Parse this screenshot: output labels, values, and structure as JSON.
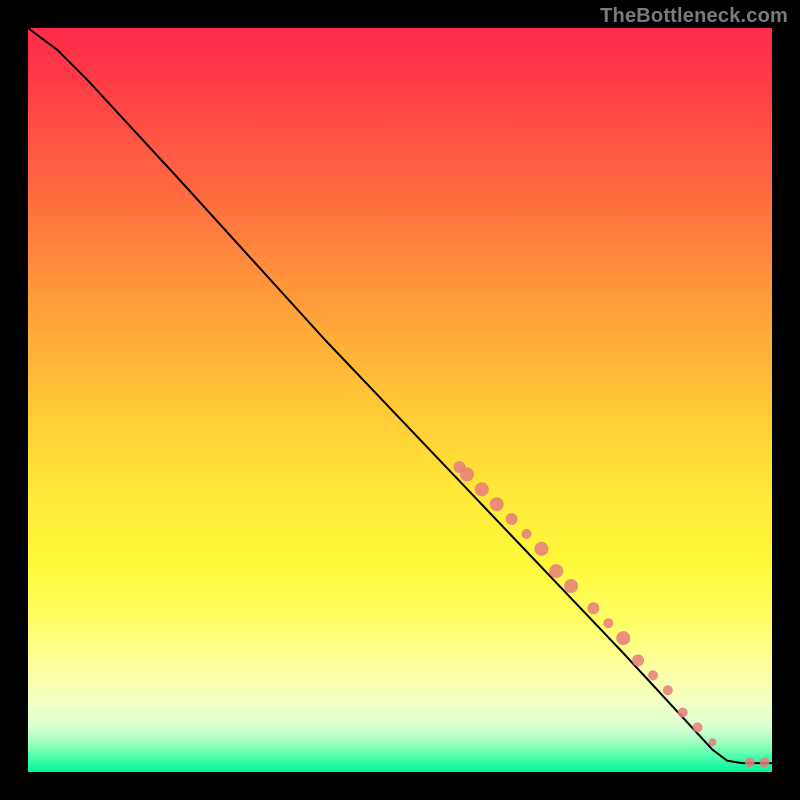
{
  "watermark": "TheBottleneck.com",
  "colors": {
    "marker": "#e67d7d",
    "curve": "#000000",
    "frame": "#000000"
  },
  "chart_data": {
    "type": "line",
    "title": "",
    "xlabel": "",
    "ylabel": "",
    "xlim": [
      0,
      100
    ],
    "ylim": [
      0,
      100
    ],
    "grid": false,
    "curve": [
      {
        "x": 0,
        "y": 100
      },
      {
        "x": 4,
        "y": 97
      },
      {
        "x": 8,
        "y": 93
      },
      {
        "x": 20,
        "y": 80
      },
      {
        "x": 40,
        "y": 58
      },
      {
        "x": 60,
        "y": 37
      },
      {
        "x": 80,
        "y": 16
      },
      {
        "x": 92,
        "y": 3
      },
      {
        "x": 94,
        "y": 1.5
      },
      {
        "x": 96,
        "y": 1.2
      },
      {
        "x": 100,
        "y": 1.2
      }
    ],
    "series": [
      {
        "name": "markers",
        "points": [
          {
            "x": 58,
            "y": 41,
            "r": 6
          },
          {
            "x": 59,
            "y": 40,
            "r": 7
          },
          {
            "x": 61,
            "y": 38,
            "r": 7
          },
          {
            "x": 63,
            "y": 36,
            "r": 7
          },
          {
            "x": 65,
            "y": 34,
            "r": 6
          },
          {
            "x": 67,
            "y": 32,
            "r": 5
          },
          {
            "x": 69,
            "y": 30,
            "r": 7
          },
          {
            "x": 71,
            "y": 27,
            "r": 7
          },
          {
            "x": 73,
            "y": 25,
            "r": 7
          },
          {
            "x": 76,
            "y": 22,
            "r": 6
          },
          {
            "x": 78,
            "y": 20,
            "r": 5
          },
          {
            "x": 80,
            "y": 18,
            "r": 7
          },
          {
            "x": 82,
            "y": 15,
            "r": 6
          },
          {
            "x": 84,
            "y": 13,
            "r": 5
          },
          {
            "x": 86,
            "y": 11,
            "r": 5
          },
          {
            "x": 88,
            "y": 8,
            "r": 5
          },
          {
            "x": 90,
            "y": 6,
            "r": 5
          },
          {
            "x": 92,
            "y": 4,
            "r": 4
          },
          {
            "x": 97,
            "y": 1.3,
            "r": 5
          },
          {
            "x": 99,
            "y": 1.3,
            "r": 5
          }
        ]
      }
    ]
  }
}
